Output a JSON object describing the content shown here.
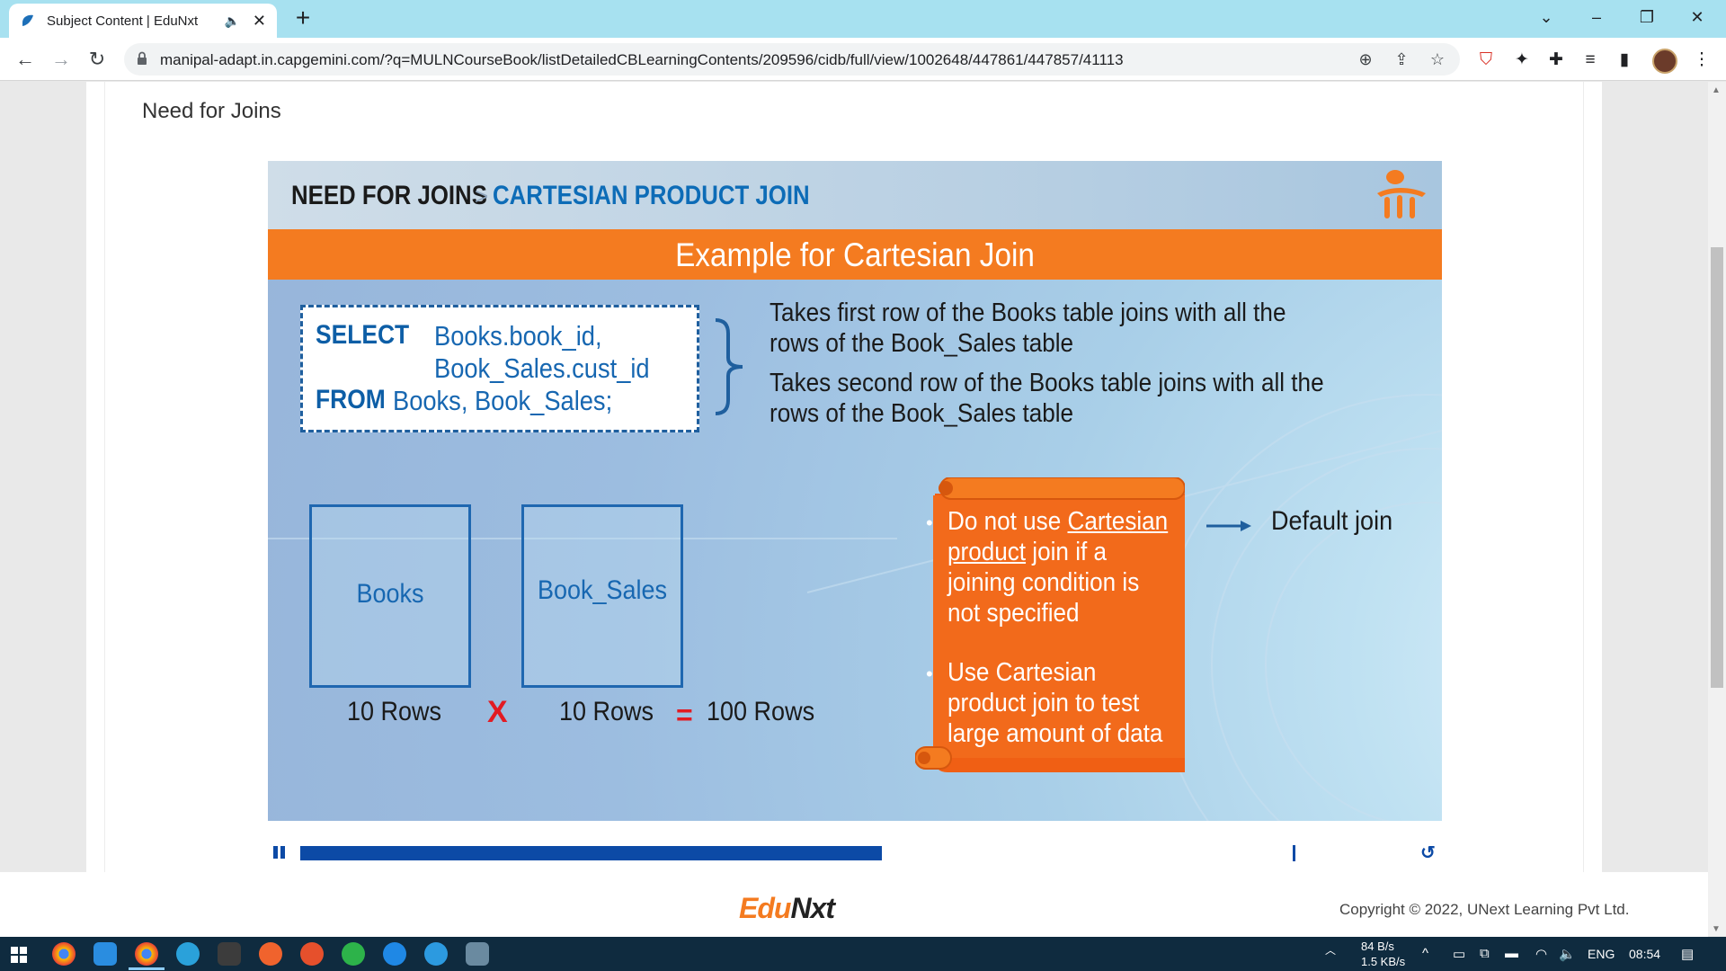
{
  "browser": {
    "tab_title": "Subject Content | EduNxt",
    "tab_audio_icon": "speaker-icon",
    "tab_close": "✕",
    "new_tab": "+",
    "url": "manipal-adapt.in.capgemini.com/?q=MULNCourseBook/listDetailedCBLearningContents/209596/cidb/full/view/1002648/447861/447857/41113"
  },
  "page": {
    "title": "Need for Joins"
  },
  "slide": {
    "breadcrumb_main": "NEED FOR JOINS",
    "breadcrumb_sep": ">",
    "breadcrumb_sub": "CARTESIAN PRODUCT JOIN",
    "banner": "Example for Cartesian Join",
    "sql": {
      "kw_select": "SELECT",
      "col1": "Books.book_id,",
      "col2": "Book_Sales.cust_id",
      "kw_from": "FROM",
      "tables": "Books, Book_Sales;"
    },
    "explanations": [
      "Takes first row of the Books table joins with all the",
      "rows of the Book_Sales table",
      "Takes second row of the Books table joins with all the",
      "rows of the Book_Sales table"
    ],
    "table1": {
      "name": "Books",
      "rows": "10 Rows"
    },
    "table2": {
      "name": "Book_Sales",
      "rows": "10 Rows"
    },
    "times_sign": "X",
    "equals_sign": "=",
    "result_rows": "100 Rows",
    "note": {
      "bullet1_pre": "Do not use ",
      "bullet1_link_a": "Cartesian",
      "bullet1_link_b": "product",
      "bullet1_l2_rest": " join if a",
      "bullet1_l3": "joining condition is",
      "bullet1_l4": "not specified",
      "bullet2_l1": "Use Cartesian",
      "bullet2_l2": "product join to test",
      "bullet2_l3": "large amount of data"
    },
    "default_join": "Default join",
    "colors": {
      "orange": "#f47b20",
      "blue": "#0d6cb7"
    }
  },
  "player": {
    "progress_fraction": 0.586
  },
  "footer": {
    "brand_a": "Edu",
    "brand_b": "Nxt",
    "copyright": "Copyright © 2022, UNext Learning Pvt Ltd."
  },
  "taskbar": {
    "net_down": "84 B/s",
    "net_up": "1.5 KB/s",
    "lang": "ENG",
    "time": "08:54"
  }
}
